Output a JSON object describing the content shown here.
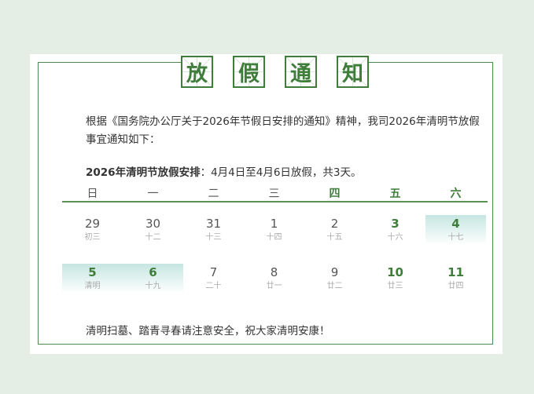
{
  "title": [
    "放",
    "假",
    "通",
    "知"
  ],
  "paragraph": "根据《国务院办公厅关于2026年节假日安排的通知》精神，我司2026年清明节放假事宜通知如下：",
  "arrangement": {
    "label": "2026年清明节放假安排",
    "text": "：4月4日至4月6日放假，共3天。"
  },
  "weekdays": [
    "日",
    "一",
    "二",
    "三",
    "四",
    "五",
    "六"
  ],
  "calendar": [
    [
      {
        "day": "29",
        "lunar": "初三",
        "weekend": false,
        "holiday": false
      },
      {
        "day": "30",
        "lunar": "十二",
        "weekend": false,
        "holiday": false
      },
      {
        "day": "31",
        "lunar": "十三",
        "weekend": false,
        "holiday": false
      },
      {
        "day": "1",
        "lunar": "十四",
        "weekend": false,
        "holiday": false
      },
      {
        "day": "2",
        "lunar": "十五",
        "weekend": false,
        "holiday": false
      },
      {
        "day": "3",
        "lunar": "十六",
        "weekend": true,
        "holiday": false
      },
      {
        "day": "4",
        "lunar": "十七",
        "weekend": true,
        "holiday": true
      }
    ],
    [
      {
        "day": "5",
        "lunar": "清明",
        "weekend": false,
        "holiday": true
      },
      {
        "day": "6",
        "lunar": "十九",
        "weekend": false,
        "holiday": true
      },
      {
        "day": "7",
        "lunar": "二十",
        "weekend": false,
        "holiday": false
      },
      {
        "day": "8",
        "lunar": "廿一",
        "weekend": false,
        "holiday": false
      },
      {
        "day": "9",
        "lunar": "廿二",
        "weekend": false,
        "holiday": false
      },
      {
        "day": "10",
        "lunar": "廿三",
        "weekend": true,
        "holiday": false
      },
      {
        "day": "11",
        "lunar": "廿四",
        "weekend": true,
        "holiday": false
      }
    ]
  ],
  "closing": "清明扫墓、踏青寻春请注意安全，祝大家清明安康！",
  "colors": {
    "accent": "#3f7d3b",
    "highlight": "#c6e6e1",
    "background": "#e4eee4"
  }
}
